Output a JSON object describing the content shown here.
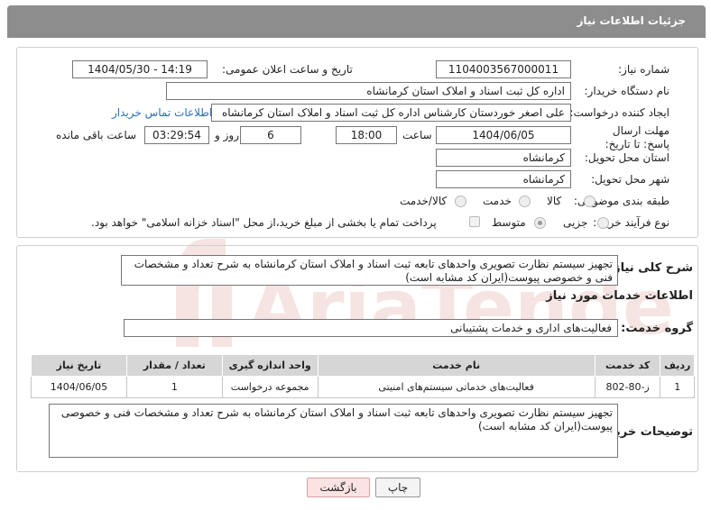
{
  "header": {
    "title": "جزئیات اطلاعات نیاز"
  },
  "form": {
    "need_number_label": "شماره نیاز:",
    "need_number": "1104003567000011",
    "announce_label": "تاریخ و ساعت اعلان عمومی:",
    "announce_value": "1404/05/30 - 14:19",
    "buyer_org_label": "نام دستگاه خریدار:",
    "buyer_org": "اداره کل ثبت اسناد و املاک استان کرمانشاه",
    "creator_label": "ایجاد کننده درخواست:",
    "creator": "علی اصغر خوردستان کارشناس اداره کل ثبت اسناد و املاک استان کرمانشاه",
    "contact_link": "اطلاعات تماس خریدار",
    "deadline_label": "مهلت ارسال پاسخ: تا تاریخ:",
    "deadline_date": "1404/06/05",
    "time_label": "ساعت",
    "deadline_time": "18:00",
    "days_value": "6",
    "days_label": "روز و",
    "remaining_time": "03:29:54",
    "remaining_label": "ساعت باقی مانده",
    "province_label": "استان محل تحویل:",
    "province": "کرمانشاه",
    "city_label": "شهر محل تحویل:",
    "city": "کرمانشاه",
    "category_label": "طبقه بندی موضوعی:",
    "category_options": [
      "کالا",
      "خدمت",
      "کالا/خدمت"
    ],
    "category_selected": "",
    "process_label": "نوع فرآیند خرید :",
    "process_options": [
      "جزیی",
      "متوسط"
    ],
    "process_selected": "متوسط",
    "payment_note": "پرداخت تمام یا بخشی از مبلغ خرید،از محل \"اسناد خزانه اسلامی\" خواهد بود."
  },
  "summary": {
    "label": "شرح کلی نیاز:",
    "text": "تجهیز سیستم نظارت تصویری واحدهای تابعه ثبت اسناد و املاک استان کرمانشاه به شرح تعداد و مشخصات فنی و خصوصی پیوست(ایران کد مشابه است)"
  },
  "services": {
    "section_title": "اطلاعات خدمات مورد نیاز",
    "group_label": "گروه خدمت:",
    "group_value": "فعالیت‌های اداری و خدمات پشتیبانی",
    "columns": [
      "ردیف",
      "کد خدمت",
      "نام خدمت",
      "واحد اندازه گیری",
      "تعداد / مقدار",
      "تاریخ نیاز"
    ],
    "rows": [
      {
        "index": "1",
        "code": "ز-80-802",
        "name": "فعالیت‌های خدماتی سیستم‌های امنیتی",
        "unit": "مجموعه درخواست",
        "qty": "1",
        "date": "1404/06/05"
      }
    ]
  },
  "buyer_notes": {
    "label": "توضیحات خریدار:",
    "text": "تجهیز سیستم نظارت تصویری واحدهای تابعه ثبت اسناد و املاک استان کرمانشاه به شرح تعداد و مشخصات فنی و خصوصی پیوست(ایران کد مشابه است)"
  },
  "buttons": {
    "print": "چاپ",
    "back": "بازگشت"
  },
  "watermark": "AriaTender.neT",
  "colors": {
    "header": "#8d8d8d",
    "link": "#2a6ebb",
    "back_button": "#fbe3e3",
    "watermark": "#c0392b"
  }
}
